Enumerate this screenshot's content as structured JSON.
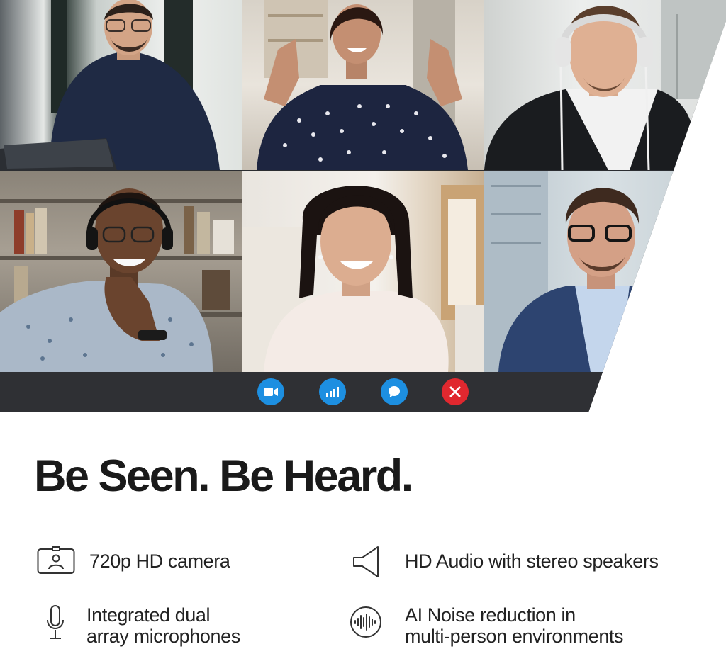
{
  "call": {
    "controls": [
      {
        "name": "video-camera-icon",
        "color": "#1d8fe1"
      },
      {
        "name": "signal-bars-icon",
        "color": "#1d8fe1"
      },
      {
        "name": "chat-bubble-icon",
        "color": "#1d8fe1"
      },
      {
        "name": "close-icon",
        "color": "#e0282f"
      }
    ]
  },
  "headline": "Be Seen. Be Heard.",
  "features": [
    {
      "icon": "camera-person-icon",
      "lines": [
        "720p HD camera"
      ]
    },
    {
      "icon": "speaker-icon",
      "lines": [
        "HD Audio with stereo speakers"
      ]
    },
    {
      "icon": "microphone-icon",
      "lines": [
        "Integrated dual",
        "array microphones"
      ]
    },
    {
      "icon": "noise-reduction-icon",
      "lines": [
        "AI Noise reduction in",
        "multi-person environments"
      ]
    }
  ]
}
